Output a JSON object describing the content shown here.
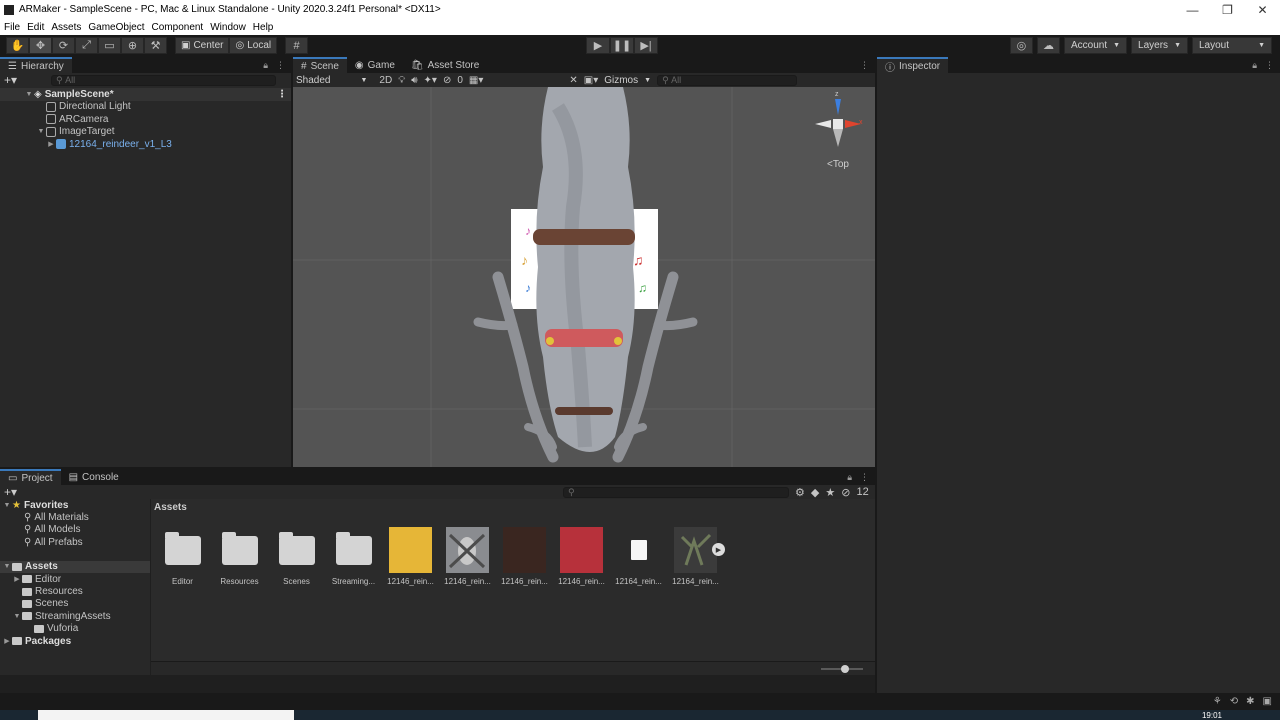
{
  "window": {
    "title": "ARMaker - SampleScene - PC, Mac & Linux Standalone - Unity 2020.3.24f1 Personal* <DX11>",
    "minimize_glyph": "—",
    "restore_glyph": "❐",
    "close_glyph": "✕"
  },
  "menu": [
    "File",
    "Edit",
    "Assets",
    "GameObject",
    "Component",
    "Window",
    "Help"
  ],
  "toolbar": {
    "center_label": "Center",
    "local_label": "Local",
    "account_label": "Account",
    "layers_label": "Layers",
    "layout_label": "Layout"
  },
  "hierarchy": {
    "tab_label": "Hierarchy",
    "search_placeholder": "All",
    "scene_name": "SampleScene*",
    "items": [
      {
        "label": "Directional Light"
      },
      {
        "label": "ARCamera"
      },
      {
        "label": "ImageTarget"
      },
      {
        "label": "12164_reindeer_v1_L3"
      }
    ]
  },
  "scene_tabs": {
    "scene": "Scene",
    "game": "Game",
    "asset_store": "Asset Store"
  },
  "scene_toolbar": {
    "shading_mode": "Shaded",
    "mode_2d": "2D",
    "hidden_count": "0",
    "gizmos_label": "Gizmos",
    "search_placeholder": "All",
    "view_label": "<Top"
  },
  "inspector": {
    "tab_label": "Inspector"
  },
  "project": {
    "project_tab": "Project",
    "console_tab": "Console",
    "hidden_packages_count": "12",
    "favorites_label": "Favorites",
    "favorites": [
      "All Materials",
      "All Models",
      "All Prefabs"
    ],
    "assets_label": "Assets",
    "asset_folders": [
      "Editor",
      "Resources",
      "Scenes",
      "StreamingAssets"
    ],
    "vuforia_label": "Vuforia",
    "packages_label": "Packages",
    "breadcrumb": "Assets",
    "grid_items": [
      {
        "label": "Editor",
        "kind": "folder"
      },
      {
        "label": "Resources",
        "kind": "folder"
      },
      {
        "label": "Scenes",
        "kind": "folder"
      },
      {
        "label": "Streaming...",
        "kind": "folder"
      },
      {
        "label": "12146_rein...",
        "kind": "texture",
        "color": "#e6b637"
      },
      {
        "label": "12146_rein...",
        "kind": "texture-fur"
      },
      {
        "label": "12146_rein...",
        "kind": "texture",
        "color": "#3a2620"
      },
      {
        "label": "12146_rein...",
        "kind": "texture",
        "color": "#b7313b"
      },
      {
        "label": "12164_rein...",
        "kind": "file"
      },
      {
        "label": "12164_rein...",
        "kind": "model"
      }
    ]
  },
  "taskbar": {
    "time": "19:01"
  },
  "colors": {
    "accent_blue": "#3a79bb",
    "prefab_blue": "#7ab1ee",
    "viewport_gray": "#545454"
  }
}
